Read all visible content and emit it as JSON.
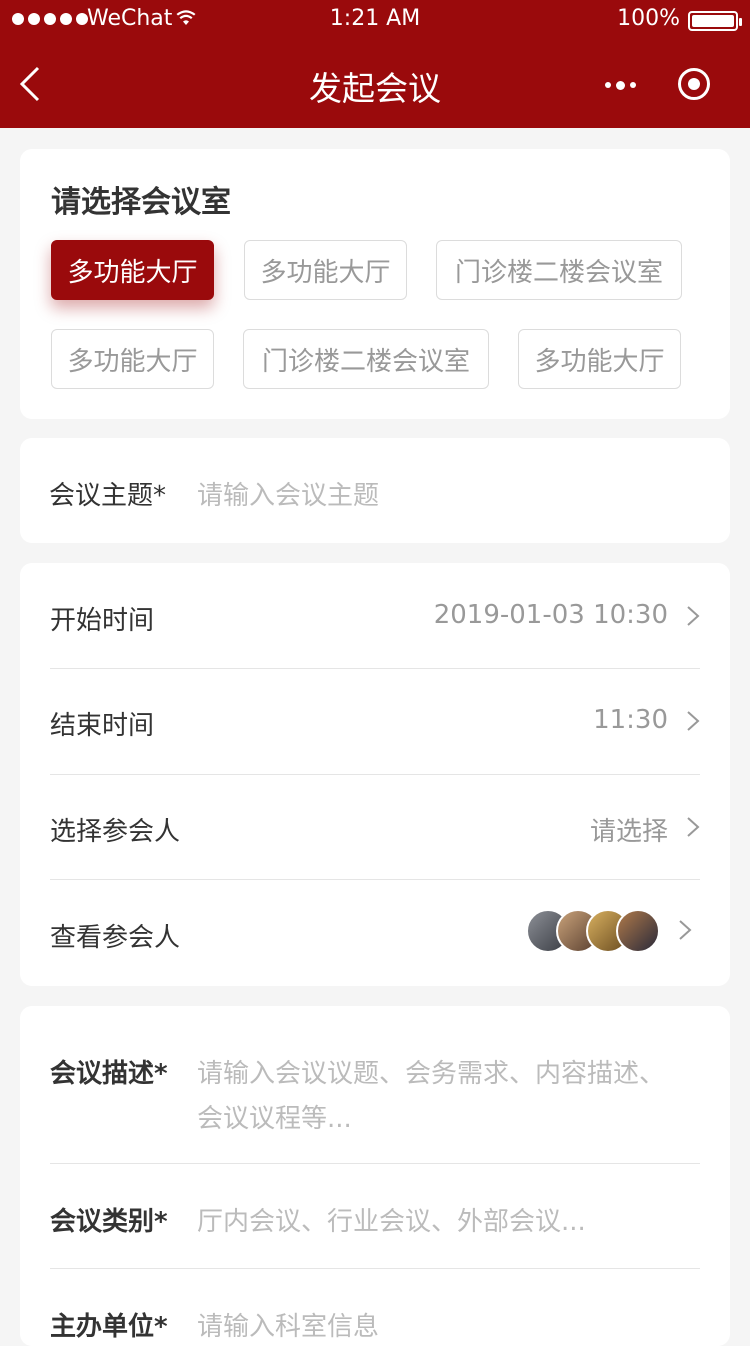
{
  "status_bar": {
    "carrier": "WeChat",
    "time": "1:21 AM",
    "battery": "100%"
  },
  "nav": {
    "title": "发起会议"
  },
  "rooms": {
    "title": "请选择会议室",
    "chips": [
      {
        "label": "多功能大厅",
        "selected": true
      },
      {
        "label": "多功能大厅",
        "selected": false
      },
      {
        "label": "门诊楼二楼会议室",
        "selected": false
      },
      {
        "label": "多功能大厅",
        "selected": false
      },
      {
        "label": "门诊楼二楼会议室",
        "selected": false
      },
      {
        "label": "多功能大厅",
        "selected": false
      }
    ]
  },
  "subject": {
    "label": "会议主题*",
    "placeholder": "请输入会议主题"
  },
  "schedule": {
    "start_label": "开始时间",
    "start_value": "2019-01-03   10:30",
    "end_label": "结束时间",
    "end_value": "11:30",
    "participants_label": "选择参会人",
    "participants_value": "请选择",
    "view_label": "查看参会人"
  },
  "details": {
    "desc_label": "会议描述*",
    "desc_placeholder_line1": "请输入会议议题、会务需求、内容描述、",
    "desc_placeholder_line2": "会议议程等...",
    "category_label": "会议类别*",
    "category_placeholder": "厅内会议、行业会议、外部会议...",
    "organizer_label": "主办单位*",
    "organizer_placeholder": "请输入科室信息"
  },
  "colors": {
    "brand": "#9a0a0c"
  }
}
